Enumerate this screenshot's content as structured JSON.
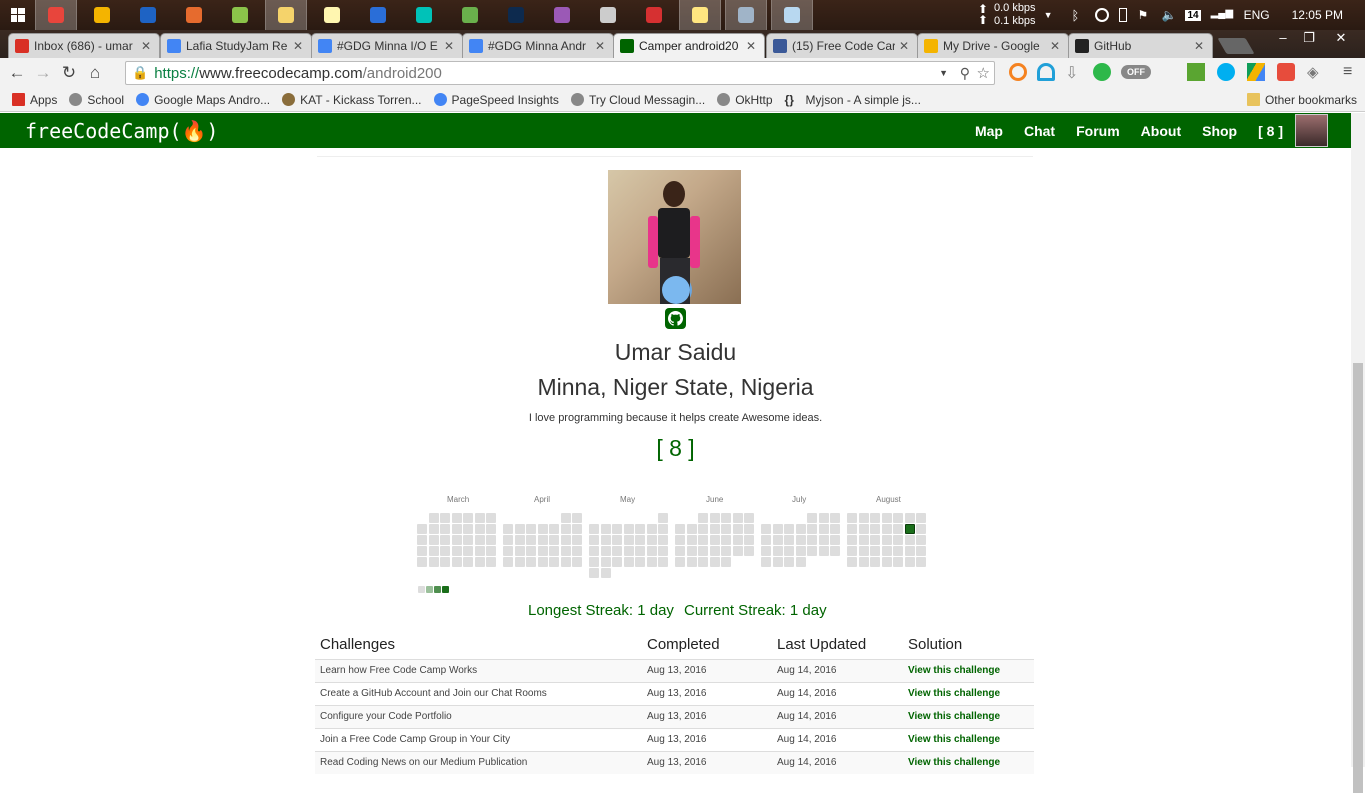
{
  "taskbar": {
    "apps": [
      {
        "icon": "chrome-icon",
        "color": "#e8453c",
        "active": true
      },
      {
        "icon": "chrome-icon",
        "color": "#f4b400",
        "active": false
      },
      {
        "icon": "firefox-icon",
        "color": "#1e63c4",
        "active": false
      },
      {
        "icon": "rss-icon",
        "color": "#e66b2e",
        "active": false
      },
      {
        "icon": "android-icon",
        "color": "#8bc34a",
        "active": false
      },
      {
        "icon": "folder-icon",
        "color": "#f5d36b",
        "active": true
      },
      {
        "icon": "notes-icon",
        "color": "#fff6b0",
        "active": false
      },
      {
        "icon": "sync-icon",
        "color": "#2a6ed8",
        "active": false
      },
      {
        "icon": "circle-app-icon",
        "color": "#00c2b8",
        "active": false
      },
      {
        "icon": "qr-icon",
        "color": "#6ab04c",
        "active": false
      },
      {
        "icon": "photoshop-icon",
        "color": "#0d2a4e",
        "active": false
      },
      {
        "icon": "sphere-icon",
        "color": "#9b59b6",
        "active": false
      },
      {
        "icon": "pen-icon",
        "color": "#cccccc",
        "active": false
      },
      {
        "icon": "video-icon",
        "color": "#d63031",
        "active": false
      },
      {
        "icon": "sticky-notes-icon",
        "color": "#ffe680",
        "active": true
      },
      {
        "icon": "monitor-icon",
        "color": "#a0b4c8",
        "active": true
      },
      {
        "icon": "notepad-icon",
        "color": "#b8d8f0",
        "active": true
      }
    ],
    "net_up": "0.0 kbps",
    "net_down": "0.1 kbps",
    "day_badge": "14",
    "language": "ENG",
    "clock": "12:05 PM"
  },
  "tabs": [
    {
      "title": "Inbox (686) - umar",
      "icon": "gmail-icon",
      "color": "#d93025",
      "active": false
    },
    {
      "title": "Lafia StudyJam Re",
      "icon": "docs-icon",
      "color": "#4285f4",
      "active": false
    },
    {
      "title": "#GDG Minna I/O E",
      "icon": "docs-icon",
      "color": "#4285f4",
      "active": false
    },
    {
      "title": "#GDG Minna Andr",
      "icon": "docs-icon",
      "color": "#4285f4",
      "active": false
    },
    {
      "title": "Camper android20",
      "icon": "fcc-icon",
      "color": "#006400",
      "active": true
    },
    {
      "title": "(15) Free Code Car",
      "icon": "facebook-icon",
      "color": "#3b5998",
      "active": false
    },
    {
      "title": "My Drive - Google",
      "icon": "drive-icon",
      "color": "#f4b400",
      "active": false
    },
    {
      "title": "GitHub",
      "icon": "github-icon",
      "color": "#222222",
      "active": false
    }
  ],
  "toolbar": {
    "url_scheme": "https://",
    "url_host": "www.freecodecamp.com",
    "url_path": "/android200",
    "toggle_label": "OFF"
  },
  "bookmarks": [
    {
      "label": "Apps",
      "icon": "apps-grid-icon"
    },
    {
      "label": "School",
      "icon": "compass-icon"
    },
    {
      "label": "Google Maps Andro...",
      "icon": "google-icon"
    },
    {
      "label": "KAT - Kickass Torren...",
      "icon": "kat-icon"
    },
    {
      "label": "PageSpeed Insights",
      "icon": "pagespeed-icon"
    },
    {
      "label": "Try Cloud Messagin...",
      "icon": "compass-icon"
    },
    {
      "label": "OkHttp",
      "icon": "compass-icon"
    },
    {
      "label": "Myjson - A simple js...",
      "icon": "braces-icon"
    }
  ],
  "other_bookmarks": "Other bookmarks",
  "fcc": {
    "logo": "freeCodeCamp(🔥)",
    "nav": [
      "Map",
      "Chat",
      "Forum",
      "About",
      "Shop",
      "[ 8 ]"
    ],
    "name": "Umar Saidu",
    "location": "Minna, Niger State, Nigeria",
    "bio": "I love programming because it helps create Awesome ideas.",
    "points": "[ 8 ]",
    "longest_streak": "Longest Streak: 1 day",
    "current_streak": "Current Streak: 1 day"
  },
  "heatmap": {
    "months": [
      "March",
      "April",
      "May",
      "June",
      "July",
      "August"
    ],
    "active_day": "August, week 6, day 2"
  },
  "table": {
    "headers": [
      "Challenges",
      "Completed",
      "Last Updated",
      "Solution"
    ],
    "rows": [
      [
        "Learn how Free Code Camp Works",
        "Aug 13, 2016",
        "Aug 14, 2016",
        "View this challenge"
      ],
      [
        "Create a GitHub Account and Join our Chat Rooms",
        "Aug 13, 2016",
        "Aug 14, 2016",
        "View this challenge"
      ],
      [
        "Configure your Code Portfolio",
        "Aug 13, 2016",
        "Aug 14, 2016",
        "View this challenge"
      ],
      [
        "Join a Free Code Camp Group in Your City",
        "Aug 13, 2016",
        "Aug 14, 2016",
        "View this challenge"
      ],
      [
        "Read Coding News on our Medium Publication",
        "Aug 13, 2016",
        "Aug 14, 2016",
        "View this challenge"
      ]
    ]
  }
}
